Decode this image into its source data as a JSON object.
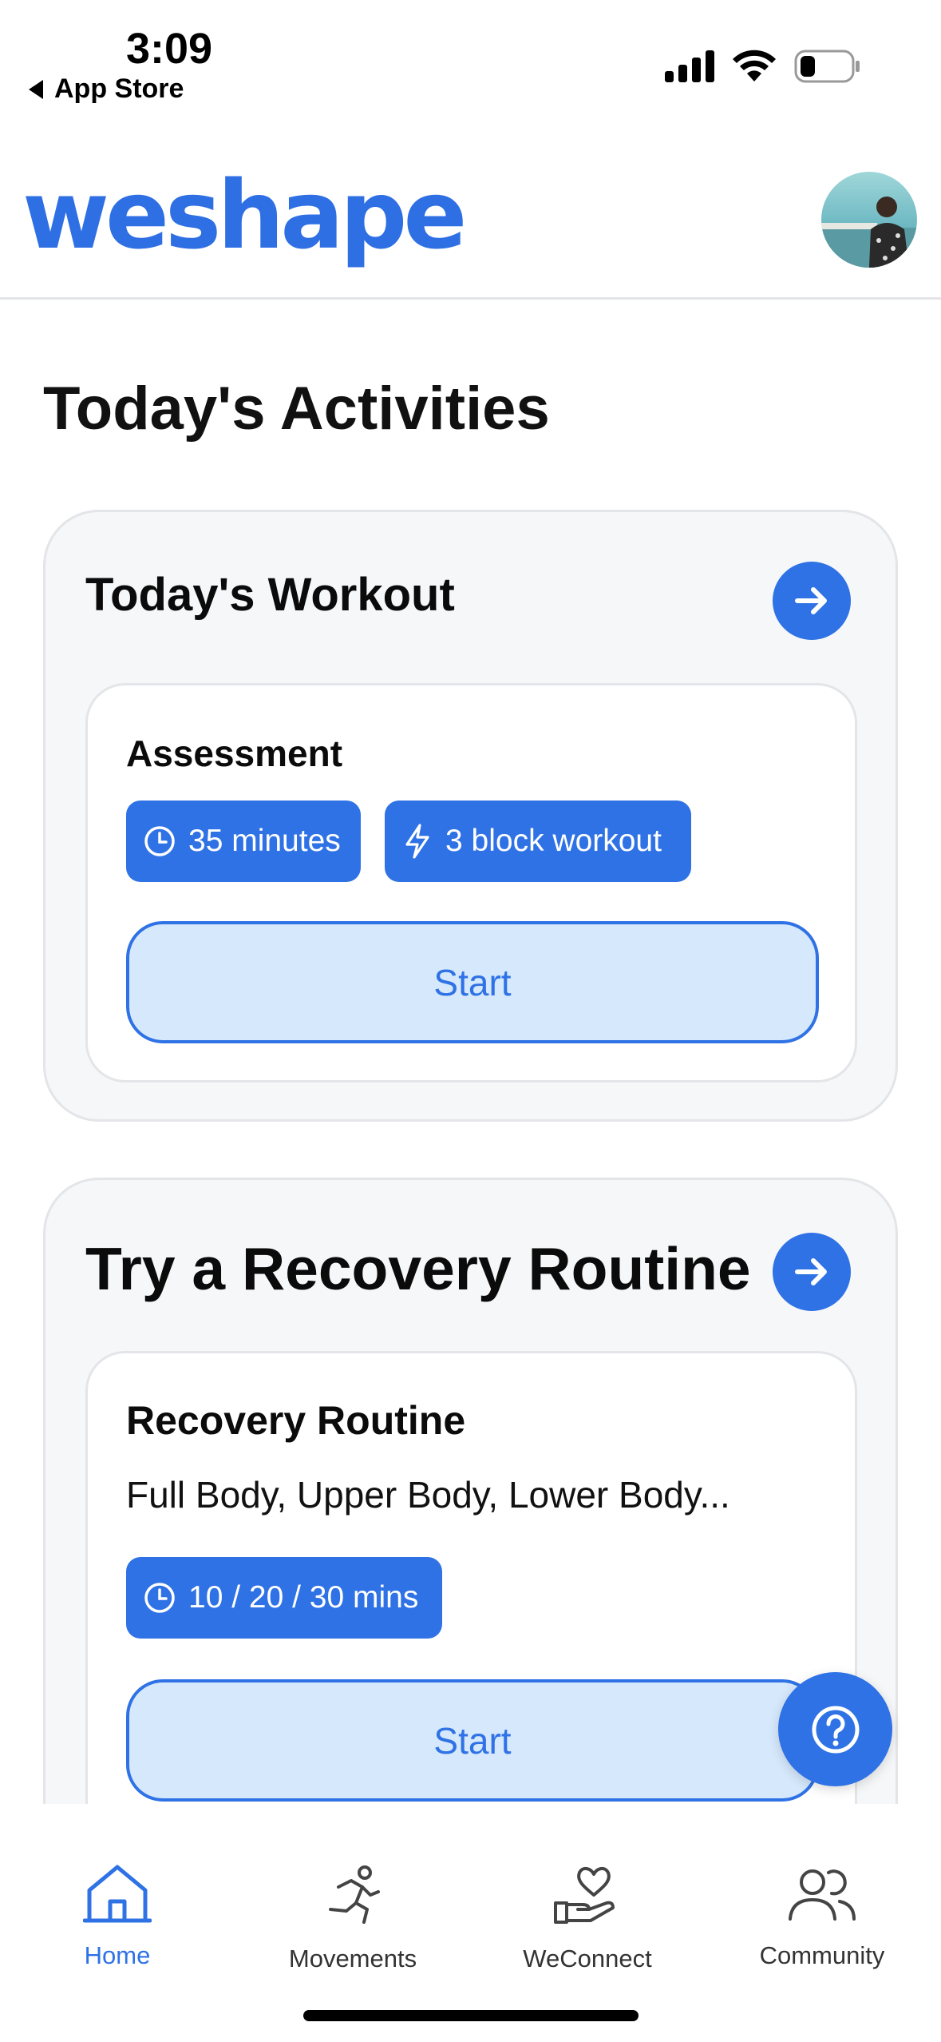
{
  "status_bar": {
    "time": "3:09",
    "back_label": "App Store"
  },
  "header": {
    "logo_text": "weshape",
    "brand_color": "#2f72e5"
  },
  "page": {
    "title": "Today's Activities"
  },
  "workout_card": {
    "title": "Today's Workout",
    "item": {
      "title": "Assessment",
      "duration": "35 minutes",
      "blocks": "3 block workout",
      "start_label": "Start"
    }
  },
  "recovery_card": {
    "title": "Try a Recovery Routine",
    "item": {
      "title": "Recovery Routine",
      "subtitle": "Full Body, Upper Body, Lower Body...",
      "duration": "10 / 20 / 30 mins",
      "start_label": "Start"
    }
  },
  "help": {
    "icon": "question-circle-icon"
  },
  "tab_bar": {
    "items": [
      {
        "label": "Home",
        "icon": "home-icon",
        "active": true
      },
      {
        "label": "Movements",
        "icon": "running-person-icon",
        "active": false
      },
      {
        "label": "WeConnect",
        "icon": "heart-hand-icon",
        "active": false
      },
      {
        "label": "Community",
        "icon": "people-icon",
        "active": false
      }
    ]
  }
}
